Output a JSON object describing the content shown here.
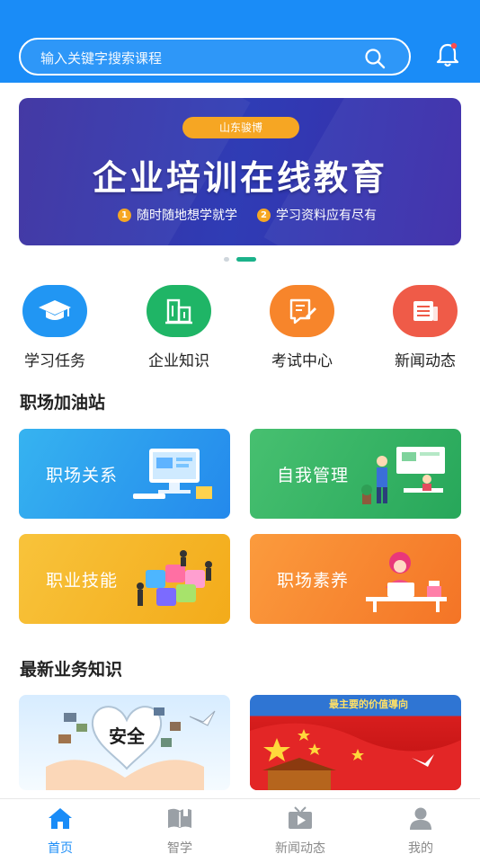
{
  "search": {
    "placeholder": "输入关键字搜索课程"
  },
  "banner": {
    "tag": "山东骏博",
    "title": "企业培训在线教育",
    "points": [
      {
        "num": "1",
        "text": "随时随地想学就学"
      },
      {
        "num": "2",
        "text": "学习资料应有尽有"
      }
    ],
    "page_index": 2,
    "page_count": 2
  },
  "quick_links": [
    {
      "label": "学习任务",
      "icon": "graduation-cap-icon",
      "color": "#2196f3"
    },
    {
      "label": "企业知识",
      "icon": "building-icon",
      "color": "#1fb566"
    },
    {
      "label": "考试中心",
      "icon": "exam-edit-icon",
      "color": "#f7852b"
    },
    {
      "label": "新闻动态",
      "icon": "newspaper-icon",
      "color": "#ef5b48"
    }
  ],
  "section_workplace": {
    "title": "职场加油站"
  },
  "workplace_cards": [
    {
      "label": "职场关系",
      "color": "#2b9cf2"
    },
    {
      "label": "自我管理",
      "color": "#33b866"
    },
    {
      "label": "职业技能",
      "color": "#f5b82a"
    },
    {
      "label": "职场素养",
      "color": "#f7862f"
    }
  ],
  "section_news": {
    "title": "最新业务知识"
  },
  "news_cards": [
    {
      "caption": "安全"
    },
    {
      "caption": "最主要的价值導向"
    }
  ],
  "tabbar": {
    "tabs": [
      {
        "label": "首页",
        "icon": "home-icon",
        "active": true
      },
      {
        "label": "智学",
        "icon": "book-icon",
        "active": false
      },
      {
        "label": "新闻动态",
        "icon": "video-icon",
        "active": false
      },
      {
        "label": "我的",
        "icon": "user-icon",
        "active": false
      }
    ]
  }
}
